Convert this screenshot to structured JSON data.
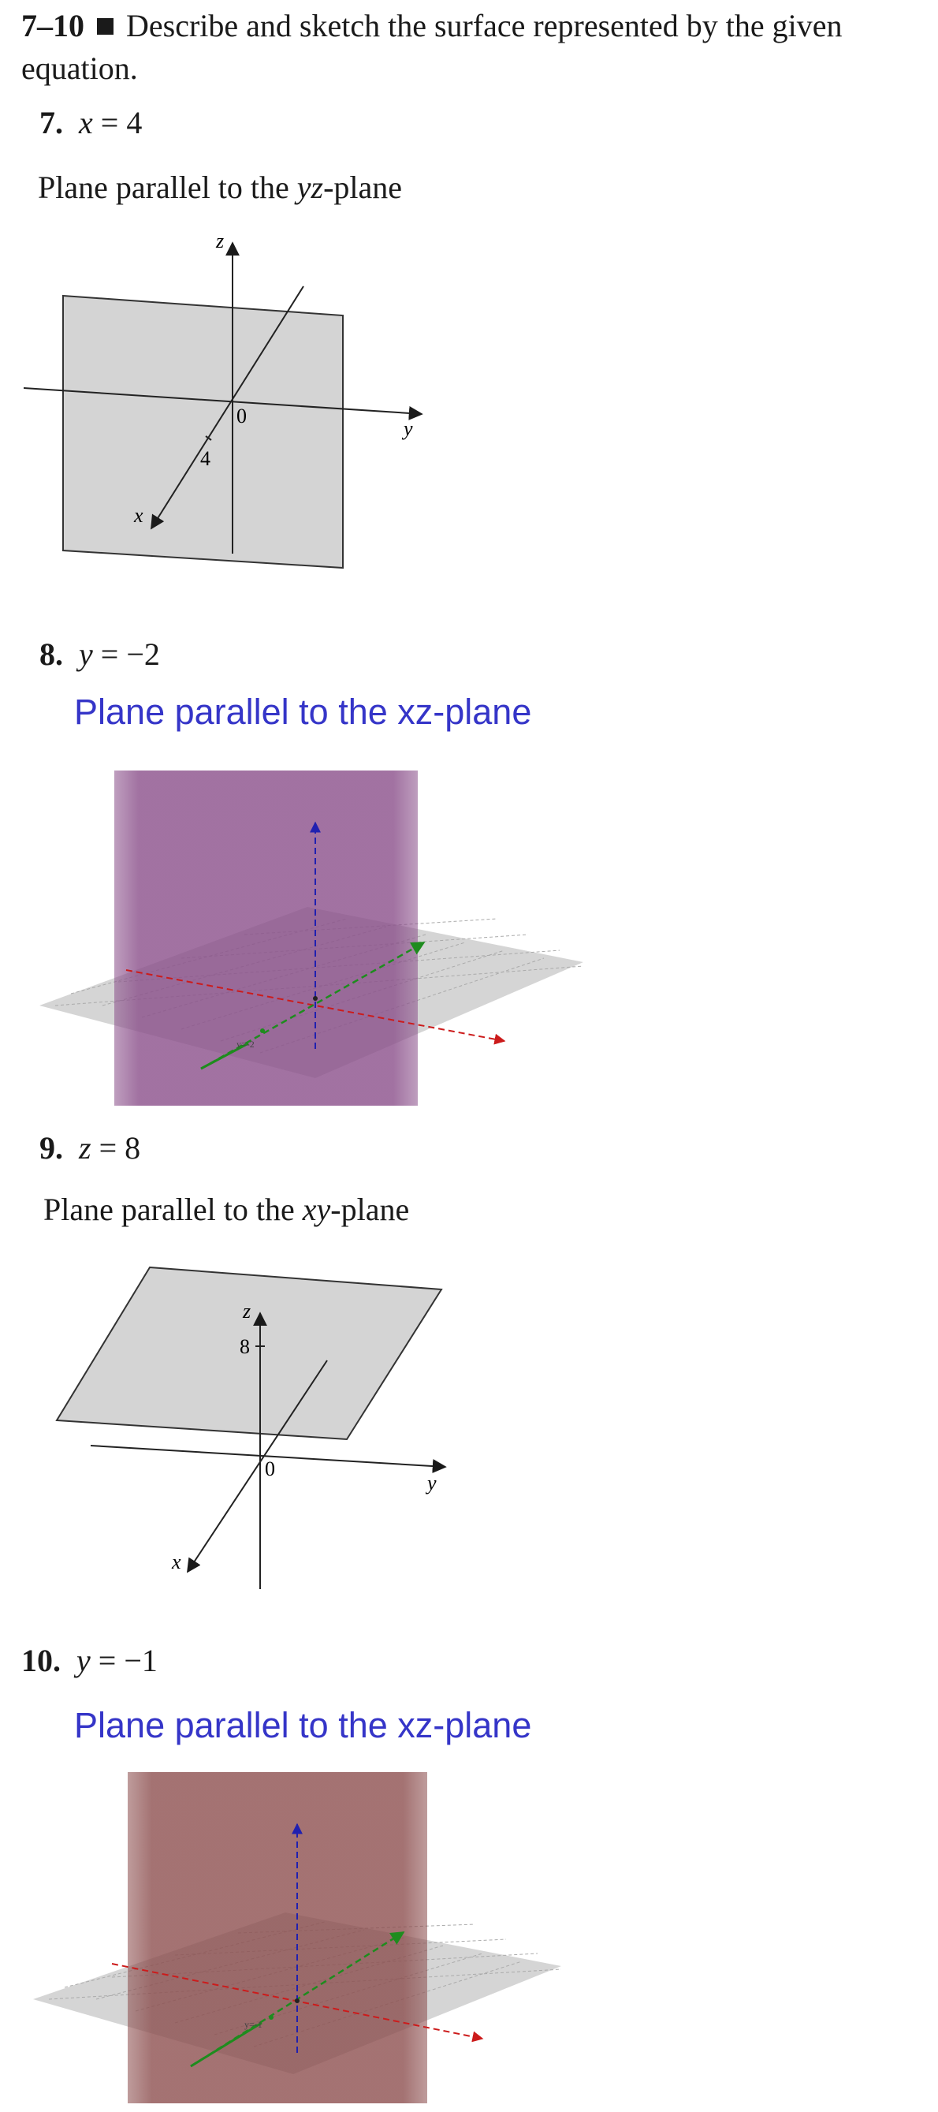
{
  "header": {
    "range": "7–10",
    "instruction_line1": "Describe and sketch the surface represented by the given",
    "instruction_line2": "equation."
  },
  "problems": [
    {
      "number": "7.",
      "equation_var": "x",
      "equation_rest": " = 4",
      "answer_pre": "Plane parallel to the ",
      "answer_var": "yz",
      "answer_post": "-plane",
      "figure": {
        "z_label": "z",
        "y_label": "y",
        "x_label": "x",
        "origin_label": "0",
        "tick_label": "4"
      }
    },
    {
      "number": "8.",
      "equation_var": "y",
      "equation_rest": " = −2",
      "answer": "Plane parallel to the xz-plane",
      "figure": {
        "plane_color": "#8a4f8a",
        "point_label": "y=-2",
        "x_axis_color": "#cc1b1b",
        "y_axis_color": "#1e8c1e",
        "z_axis_color": "#2020b0"
      }
    },
    {
      "number": "9.",
      "equation_var": "z",
      "equation_rest": " = 8",
      "answer_pre": "Plane parallel to the ",
      "answer_var": "xy",
      "answer_post": "-plane",
      "figure": {
        "z_label": "z",
        "y_label": "y",
        "x_label": "x",
        "origin_label": "0",
        "tick_label": "8"
      }
    },
    {
      "number": "10.",
      "equation_var": "y",
      "equation_rest": " = −1",
      "answer": "Plane parallel to the xz-plane",
      "figure": {
        "plane_color": "#8a4b4b",
        "point_label": "y=-1",
        "x_axis_color": "#cc1b1b",
        "y_axis_color": "#1e8c1e",
        "z_axis_color": "#2020b0"
      }
    }
  ]
}
